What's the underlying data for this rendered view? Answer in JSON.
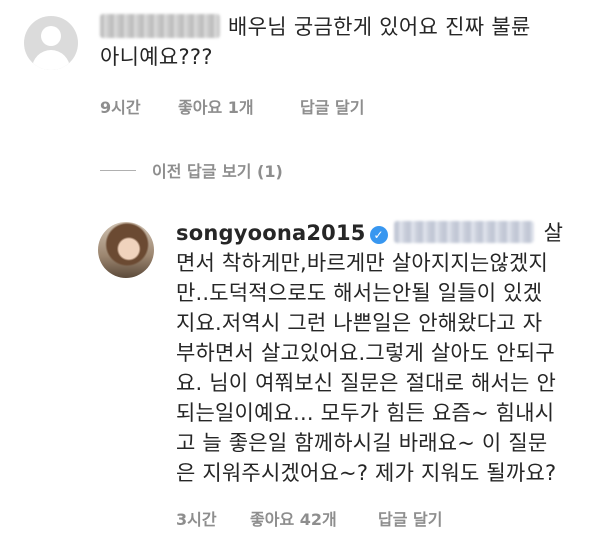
{
  "comment": {
    "text_line1": "배우님 궁금한게 있어요 진짜 불륜",
    "text_line2": "아니예요???",
    "time": "9시간",
    "likes": "좋아요 1개",
    "reply_label": "답글 달기"
  },
  "view_previous_replies": "이전 답글 보기 (1)",
  "reply": {
    "username": "songyoona2015",
    "verified_icon": "verified-badge-icon",
    "lines": [
      "살",
      "면서 착하게만,바르게만 살아지지는않겠지",
      "만..도덕적으로도 해서는안될 일들이 있겠",
      "지요.저역시 그런 나쁜일은 안해왔다고 자",
      "부하면서 살고있어요.그렇게 살아도 안되구",
      "요. 님이 여쭤보신 질문은 절대로 해서는 안",
      "되는일이예요... 모두가 힘든 요즘~ 힘내시",
      "고 늘 좋은일 함께하시길 바래요~ 이 질문",
      "은 지워주시겠어요~? 제가 지워도 될까요?"
    ],
    "time": "3시간",
    "likes": "좋아요 42개",
    "reply_label": "답글 달기"
  }
}
